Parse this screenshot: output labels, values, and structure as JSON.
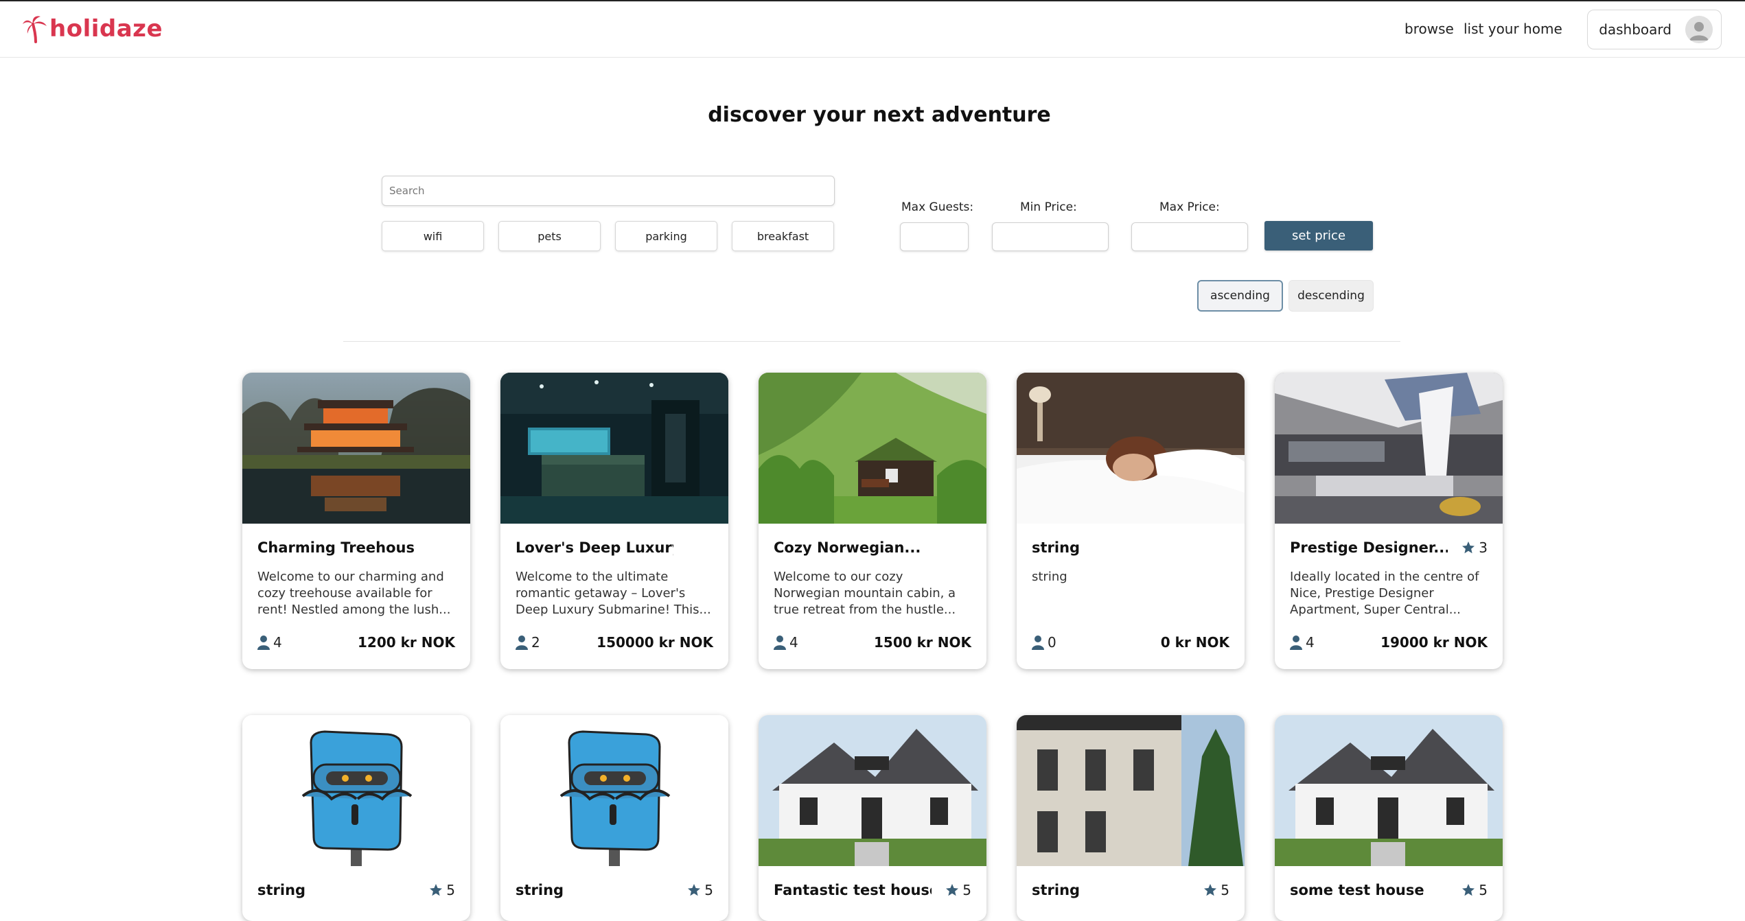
{
  "brand": {
    "name": "holidaze",
    "color": "#d9364f"
  },
  "nav": {
    "browse": "browse",
    "list_home": "list your home",
    "dashboard": "dashboard"
  },
  "hero": {
    "title": "discover your next adventure"
  },
  "search": {
    "placeholder": "Search",
    "value": ""
  },
  "amenities": [
    "wifi",
    "pets",
    "parking",
    "breakfast"
  ],
  "filters": {
    "max_guests_label": "Max Guests:",
    "min_price_label": "Min Price:",
    "max_price_label": "Max Price:",
    "max_guests": "",
    "min_price": "",
    "max_price": "",
    "set_price": "set price"
  },
  "sort": {
    "ascending": "ascending",
    "descending": "descending",
    "selected": "ascending"
  },
  "accent_color": "#3a5f78",
  "venues": [
    {
      "title": "Charming Treehouse ...",
      "rating": "",
      "description": "Welcome to our charming and cozy treehouse available for rent! Nestled among the lush...",
      "guests": "4",
      "price": "1200 kr NOK",
      "image": "treehouse-photo"
    },
    {
      "title": "Lover's Deep Luxury...",
      "rating": "",
      "description": "Welcome to the ultimate romantic getaway – Lover's Deep Luxury Submarine! This...",
      "guests": "2",
      "price": "150000 kr NOK",
      "image": "submarine-bedroom-photo"
    },
    {
      "title": "Cozy Norwegian...",
      "rating": "",
      "description": "Welcome to our cozy Norwegian mountain cabin, a true retreat from the hustle...",
      "guests": "4",
      "price": "1500 kr NOK",
      "image": "cabin-photo"
    },
    {
      "title": "string",
      "rating": "",
      "description": "string",
      "guests": "0",
      "price": "0 kr NOK",
      "image": "sleeping-woman-photo"
    },
    {
      "title": "Prestige Designer...",
      "rating": "3",
      "description": "Ideally located in the centre of Nice, Prestige Designer Apartment, Super Central...",
      "guests": "4",
      "price": "19000 kr NOK",
      "image": "apartment-photo"
    },
    {
      "title": "string",
      "rating": "5",
      "image": "robot-illustration"
    },
    {
      "title": "string",
      "rating": "5",
      "image": "robot-illustration"
    },
    {
      "title": "Fantastic test house",
      "rating": "5",
      "image": "white-house-photo"
    },
    {
      "title": "string",
      "rating": "5",
      "image": "townhouse-photo"
    },
    {
      "title": "some test house",
      "rating": "5",
      "image": "white-house-photo"
    }
  ]
}
